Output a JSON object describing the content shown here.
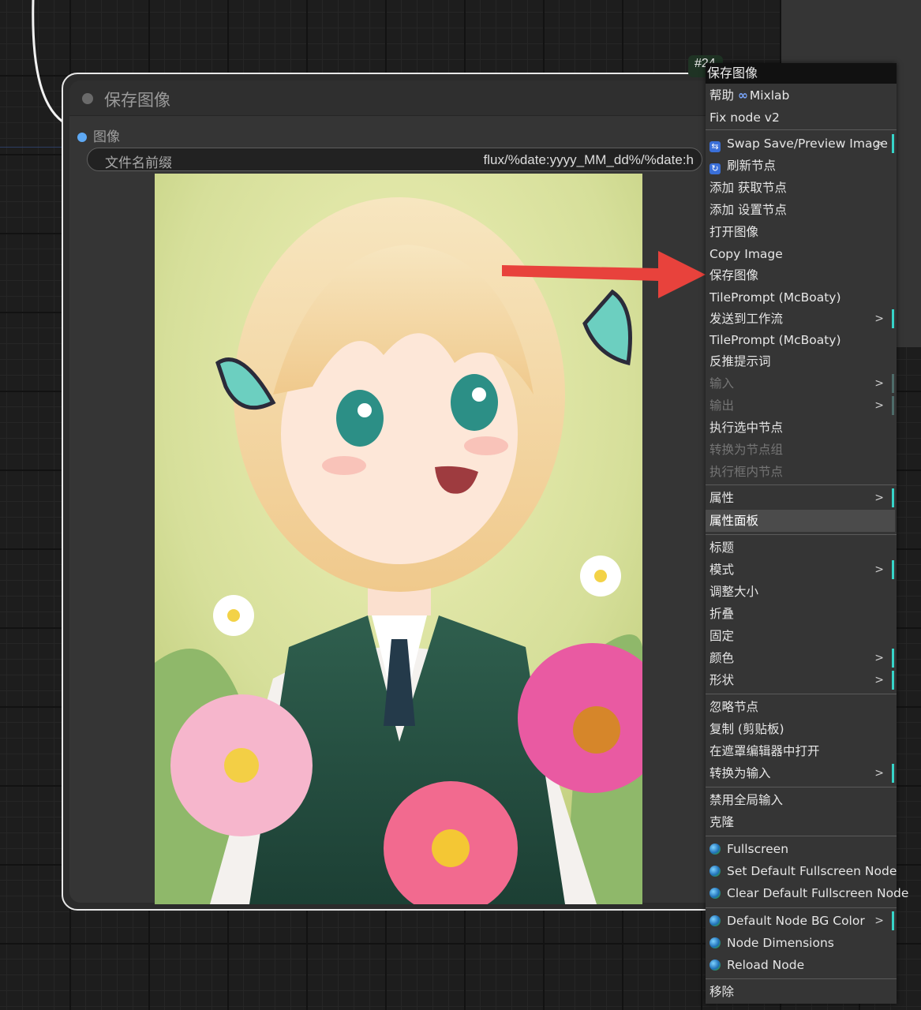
{
  "node": {
    "id_badge": "#24",
    "title": "保存图像",
    "input_label": "图像",
    "widget_label": "文件名前缀",
    "widget_value": "flux/%date:yyyy_MM_dd%/%date:h"
  },
  "colors": {
    "accent_bar": "#36d3c8",
    "input_slot": "#5ea9f4",
    "annotation_arrow": "#e8423c",
    "menu_bg": "#353535"
  },
  "menu": {
    "title": "保存图像",
    "items": [
      {
        "label": "帮助",
        "suffix": "Mixlab",
        "icon": "infinity-icon"
      },
      {
        "label": "Fix node v2"
      },
      {
        "label": "Swap Save/Preview Image",
        "icon": "swap-icon",
        "submenu": true
      },
      {
        "label": "刷新节点",
        "icon": "refresh-icon"
      },
      {
        "label": "添加 获取节点"
      },
      {
        "label": "添加 设置节点"
      },
      {
        "label": "打开图像"
      },
      {
        "label": "Copy Image"
      },
      {
        "label": "保存图像"
      },
      {
        "label": "TilePrompt (McBoaty)"
      },
      {
        "label": "发送到工作流",
        "submenu": true
      },
      {
        "label": "TilePrompt (McBoaty)"
      },
      {
        "label": "反推提示词"
      },
      {
        "label": "输入",
        "submenu": true,
        "disabled": true
      },
      {
        "label": "输出",
        "submenu": true,
        "disabled": true
      },
      {
        "label": "执行选中节点"
      },
      {
        "label": "转换为节点组",
        "disabled": true
      },
      {
        "label": "执行框内节点",
        "disabled": true
      },
      {
        "label": "属性",
        "submenu": true
      },
      {
        "label": "属性面板",
        "highlighted": true
      },
      {
        "label": "标题"
      },
      {
        "label": "模式",
        "submenu": true
      },
      {
        "label": "调整大小"
      },
      {
        "label": "折叠"
      },
      {
        "label": "固定"
      },
      {
        "label": "颜色",
        "submenu": true
      },
      {
        "label": "形状",
        "submenu": true
      },
      {
        "label": "忽略节点"
      },
      {
        "label": "复制 (剪贴板)"
      },
      {
        "label": "在遮罩编辑器中打开"
      },
      {
        "label": "转换为输入",
        "submenu": true
      },
      {
        "label": "禁用全局输入"
      },
      {
        "label": "克隆"
      },
      {
        "label": "Fullscreen",
        "icon": "globe-icon"
      },
      {
        "label": "Set Default Fullscreen Node",
        "icon": "globe-icon"
      },
      {
        "label": "Clear Default Fullscreen Node",
        "icon": "globe-icon"
      },
      {
        "label": "Default Node BG Color",
        "icon": "globe-icon",
        "submenu": true
      },
      {
        "label": "Node Dimensions",
        "icon": "globe-icon"
      },
      {
        "label": "Reload Node",
        "icon": "globe-icon"
      },
      {
        "label": "移除"
      }
    ],
    "submenu_glyph": ">"
  }
}
